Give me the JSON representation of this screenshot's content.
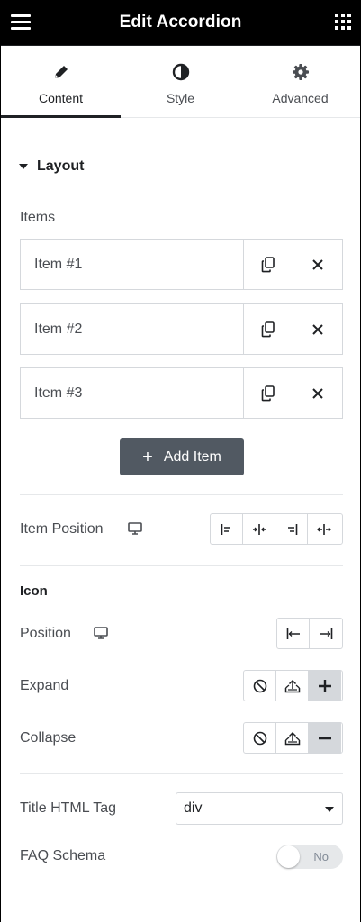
{
  "header": {
    "title": "Edit Accordion",
    "menu_icon": "hamburger-icon",
    "widgets_icon": "grid-icon"
  },
  "tabs": [
    {
      "label": "Content",
      "icon": "pencil-icon",
      "active": true
    },
    {
      "label": "Style",
      "icon": "half-circle-icon",
      "active": false
    },
    {
      "label": "Advanced",
      "icon": "gear-icon",
      "active": false
    }
  ],
  "layout": {
    "section_title": "Layout",
    "items_label": "Items",
    "items": [
      {
        "title": "Item #1"
      },
      {
        "title": "Item #2"
      },
      {
        "title": "Item #3"
      }
    ],
    "add_item_label": "Add Item",
    "item_position_label": "Item Position",
    "item_position_options": [
      "align-start-icon",
      "align-center-icon",
      "align-end-icon",
      "stretch-icon"
    ]
  },
  "icon_section": {
    "title": "Icon",
    "position_label": "Position",
    "position_options": [
      "icon-start-icon",
      "icon-end-icon"
    ],
    "expand_label": "Expand",
    "expand_options": [
      "none-icon",
      "upload-icon",
      "plus-icon"
    ],
    "expand_selected": "plus-icon",
    "collapse_label": "Collapse",
    "collapse_options": [
      "none-icon",
      "upload-icon",
      "minus-icon"
    ],
    "collapse_selected": "minus-icon"
  },
  "title_tag": {
    "label": "Title HTML Tag",
    "value": "div"
  },
  "faq_schema": {
    "label": "FAQ Schema",
    "value": "No"
  },
  "colors": {
    "header_bg": "#000000",
    "button_bg": "#515962",
    "border": "#d5d8dc",
    "selected_bg": "#d5d8dc"
  }
}
